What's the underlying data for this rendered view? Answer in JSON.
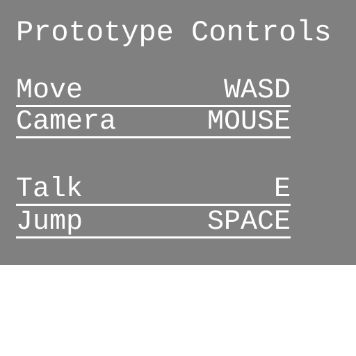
{
  "panel": {
    "title": "Prototype Controls",
    "controls": [
      {
        "action": "Move",
        "key": "WASD"
      },
      {
        "action": "Camera",
        "key": "MOUSE"
      },
      {
        "action": "Talk",
        "key": "E"
      },
      {
        "action": "Jump",
        "key": "SPACE"
      }
    ]
  },
  "colors": {
    "panel_background": "#808080",
    "text": "#ffffff",
    "page_background": "#ffffff"
  }
}
